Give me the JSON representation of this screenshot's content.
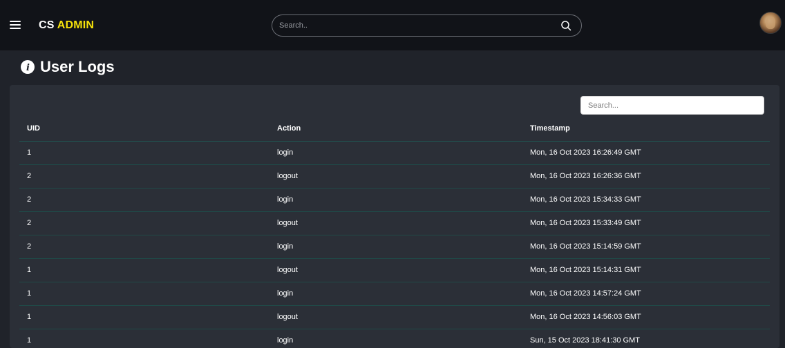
{
  "header": {
    "brand_prefix": "CS",
    "brand_accent": "ADMIN",
    "search_placeholder": "Search..",
    "accent_color": "#f6e20b"
  },
  "page": {
    "title": "User Logs",
    "title_icon": "info-circle-icon"
  },
  "table": {
    "search_placeholder": "Search...",
    "columns": [
      "UID",
      "Action",
      "Timestamp"
    ],
    "rows": [
      {
        "uid": "1",
        "action": "login",
        "timestamp": "Mon, 16 Oct 2023 16:26:49 GMT"
      },
      {
        "uid": "2",
        "action": "logout",
        "timestamp": "Mon, 16 Oct 2023 16:26:36 GMT"
      },
      {
        "uid": "2",
        "action": "login",
        "timestamp": "Mon, 16 Oct 2023 15:34:33 GMT"
      },
      {
        "uid": "2",
        "action": "logout",
        "timestamp": "Mon, 16 Oct 2023 15:33:49 GMT"
      },
      {
        "uid": "2",
        "action": "login",
        "timestamp": "Mon, 16 Oct 2023 15:14:59 GMT"
      },
      {
        "uid": "1",
        "action": "logout",
        "timestamp": "Mon, 16 Oct 2023 15:14:31 GMT"
      },
      {
        "uid": "1",
        "action": "login",
        "timestamp": "Mon, 16 Oct 2023 14:57:24 GMT"
      },
      {
        "uid": "1",
        "action": "logout",
        "timestamp": "Mon, 16 Oct 2023 14:56:03 GMT"
      },
      {
        "uid": "1",
        "action": "login",
        "timestamp": "Sun, 15 Oct 2023 18:41:30 GMT"
      }
    ]
  }
}
